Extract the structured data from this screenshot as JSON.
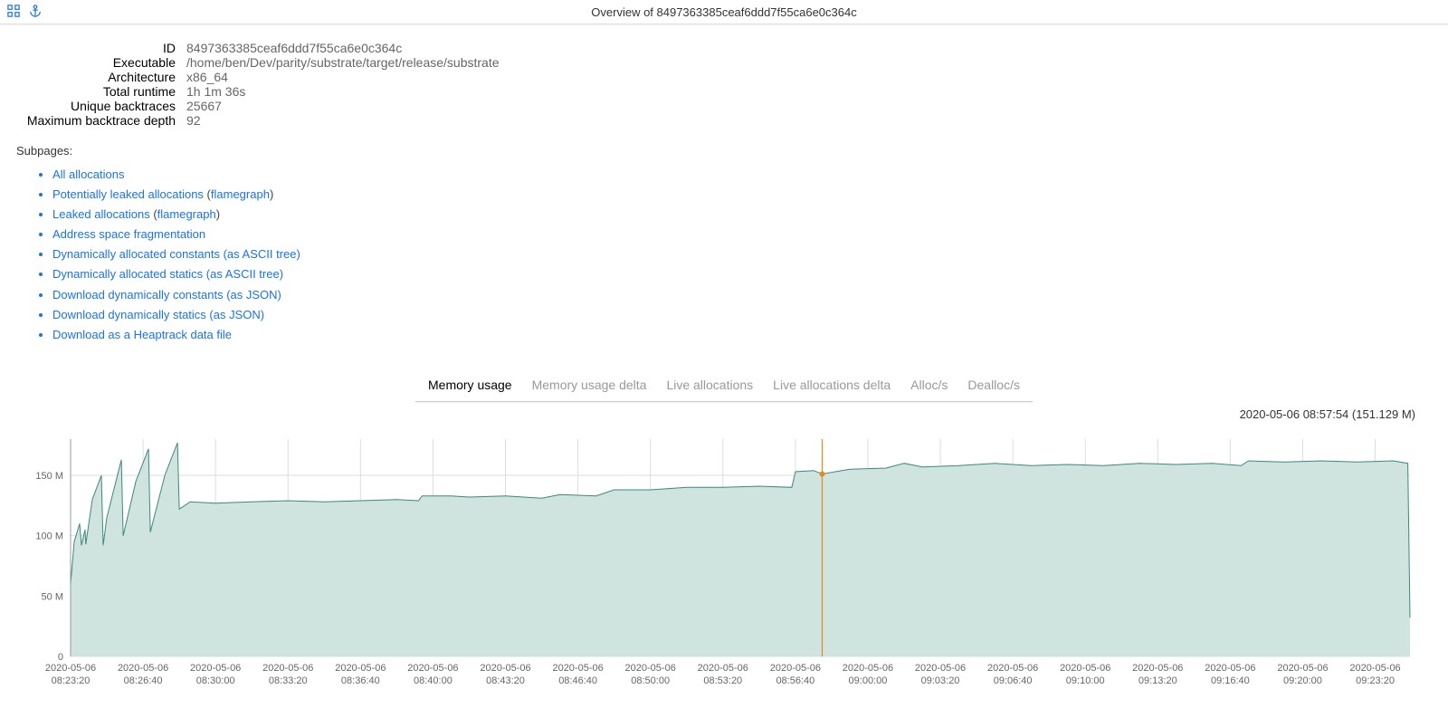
{
  "header": {
    "title": "Overview of 8497363385ceaf6ddd7f55ca6e0c364c"
  },
  "meta": [
    {
      "label": "ID",
      "value": "8497363385ceaf6ddd7f55ca6e0c364c"
    },
    {
      "label": "Executable",
      "value": "/home/ben/Dev/parity/substrate/target/release/substrate"
    },
    {
      "label": "Architecture",
      "value": "x86_64"
    },
    {
      "label": "Total runtime",
      "value": "1h 1m 36s"
    },
    {
      "label": "Unique backtraces",
      "value": "25667"
    },
    {
      "label": "Maximum backtrace depth",
      "value": "92"
    }
  ],
  "subpages": {
    "heading": "Subpages:",
    "items": [
      {
        "parts": [
          {
            "text": "All allocations",
            "link": true
          }
        ]
      },
      {
        "parts": [
          {
            "text": "Potentially leaked allocations",
            "link": true
          },
          {
            "text": " (",
            "link": false
          },
          {
            "text": "flamegraph",
            "link": true
          },
          {
            "text": ")",
            "link": false
          }
        ]
      },
      {
        "parts": [
          {
            "text": "Leaked allocations",
            "link": true
          },
          {
            "text": " (",
            "link": false
          },
          {
            "text": "flamegraph",
            "link": true
          },
          {
            "text": ")",
            "link": false
          }
        ]
      },
      {
        "parts": [
          {
            "text": "Address space fragmentation",
            "link": true
          }
        ]
      },
      {
        "parts": [
          {
            "text": "Dynamically allocated constants (as ASCII tree)",
            "link": true
          }
        ]
      },
      {
        "parts": [
          {
            "text": "Dynamically allocated statics (as ASCII tree)",
            "link": true
          }
        ]
      },
      {
        "parts": [
          {
            "text": "Download dynamically constants (as JSON)",
            "link": true
          }
        ]
      },
      {
        "parts": [
          {
            "text": "Download dynamically statics (as JSON)",
            "link": true
          }
        ]
      },
      {
        "parts": [
          {
            "text": "Download as a Heaptrack data file",
            "link": true
          }
        ]
      }
    ]
  },
  "tabs": [
    {
      "label": "Memory usage",
      "active": true
    },
    {
      "label": "Memory usage delta",
      "active": false
    },
    {
      "label": "Live allocations",
      "active": false
    },
    {
      "label": "Live allocations delta",
      "active": false
    },
    {
      "label": "Alloc/s",
      "active": false
    },
    {
      "label": "Dealloc/s",
      "active": false
    }
  ],
  "chart_tooltip": "2020-05-06 08:57:54 (151.129 M)",
  "chart_data": {
    "type": "area",
    "ylabel": "",
    "ylim": [
      0,
      180
    ],
    "yticks": [
      0,
      50,
      100,
      150
    ],
    "ytick_labels": [
      "0",
      "50 M",
      "100 M",
      "150 M"
    ],
    "x_range_seconds": [
      0,
      3696
    ],
    "xtick_seconds": [
      0,
      200,
      400,
      600,
      800,
      1000,
      1200,
      1400,
      1600,
      1800,
      2000,
      2200,
      2400,
      2600,
      2800,
      3000,
      3200,
      3400,
      3600
    ],
    "xtick_labels": [
      [
        "2020-05-06",
        "08:23:20"
      ],
      [
        "2020-05-06",
        "08:26:40"
      ],
      [
        "2020-05-06",
        "08:30:00"
      ],
      [
        "2020-05-06",
        "08:33:20"
      ],
      [
        "2020-05-06",
        "08:36:40"
      ],
      [
        "2020-05-06",
        "08:40:00"
      ],
      [
        "2020-05-06",
        "08:43:20"
      ],
      [
        "2020-05-06",
        "08:46:40"
      ],
      [
        "2020-05-06",
        "08:50:00"
      ],
      [
        "2020-05-06",
        "08:53:20"
      ],
      [
        "2020-05-06",
        "08:56:40"
      ],
      [
        "2020-05-06",
        "09:00:00"
      ],
      [
        "2020-05-06",
        "09:03:20"
      ],
      [
        "2020-05-06",
        "09:06:40"
      ],
      [
        "2020-05-06",
        "09:10:00"
      ],
      [
        "2020-05-06",
        "09:13:20"
      ],
      [
        "2020-05-06",
        "09:16:40"
      ],
      [
        "2020-05-06",
        "09:20:00"
      ],
      [
        "2020-05-06",
        "09:23:20"
      ]
    ],
    "cursor": {
      "t": 2074,
      "y": 151.129
    },
    "series": [
      {
        "name": "memory_usage_M",
        "points": [
          [
            0,
            60
          ],
          [
            10,
            95
          ],
          [
            25,
            110
          ],
          [
            30,
            92
          ],
          [
            40,
            105
          ],
          [
            42,
            93
          ],
          [
            60,
            130
          ],
          [
            85,
            150
          ],
          [
            90,
            92
          ],
          [
            100,
            115
          ],
          [
            140,
            163
          ],
          [
            145,
            100
          ],
          [
            180,
            145
          ],
          [
            215,
            172
          ],
          [
            220,
            103
          ],
          [
            260,
            150
          ],
          [
            295,
            177
          ],
          [
            300,
            122
          ],
          [
            330,
            128
          ],
          [
            400,
            127
          ],
          [
            500,
            128
          ],
          [
            600,
            129
          ],
          [
            700,
            128
          ],
          [
            800,
            129
          ],
          [
            900,
            130
          ],
          [
            960,
            129
          ],
          [
            970,
            133
          ],
          [
            1050,
            133
          ],
          [
            1100,
            132
          ],
          [
            1200,
            133
          ],
          [
            1300,
            131
          ],
          [
            1350,
            134
          ],
          [
            1450,
            133
          ],
          [
            1500,
            138
          ],
          [
            1600,
            138
          ],
          [
            1700,
            140
          ],
          [
            1800,
            140
          ],
          [
            1900,
            141
          ],
          [
            1990,
            140
          ],
          [
            2000,
            153
          ],
          [
            2050,
            154
          ],
          [
            2074,
            151.129
          ],
          [
            2150,
            155
          ],
          [
            2250,
            156
          ],
          [
            2300,
            160
          ],
          [
            2350,
            157
          ],
          [
            2450,
            158
          ],
          [
            2550,
            160
          ],
          [
            2650,
            158
          ],
          [
            2750,
            159
          ],
          [
            2850,
            158
          ],
          [
            2950,
            160
          ],
          [
            3050,
            159
          ],
          [
            3150,
            160
          ],
          [
            3230,
            158
          ],
          [
            3250,
            162
          ],
          [
            3350,
            161
          ],
          [
            3450,
            162
          ],
          [
            3550,
            161
          ],
          [
            3650,
            162
          ],
          [
            3690,
            160
          ],
          [
            3696,
            32
          ]
        ]
      }
    ],
    "colors": {
      "area": "#cfe3df",
      "line": "#3f887d",
      "cursor": "#e08a1f"
    }
  }
}
